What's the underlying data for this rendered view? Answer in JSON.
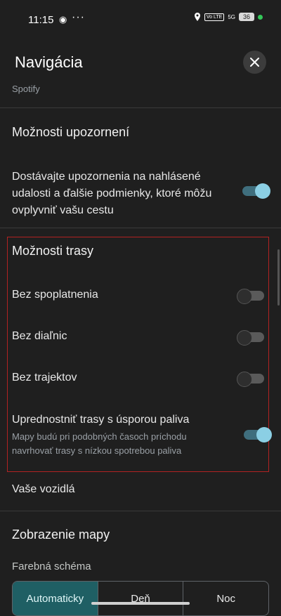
{
  "status": {
    "time": "11:15",
    "battery": "36",
    "net": "5G",
    "volte": "Vo LTE"
  },
  "header": {
    "title": "Navigácia"
  },
  "spotify_label": "Spotify",
  "notifications": {
    "title": "Možnosti upozornení",
    "description": "Dostávajte upozornenia na nahlásené udalosti a ďalšie podmienky, ktoré môžu ovplyvniť vašu cestu",
    "enabled": true
  },
  "route_options": {
    "title": "Možnosti trasy",
    "items": [
      {
        "label": "Bez spoplatnenia",
        "enabled": false
      },
      {
        "label": "Bez diaľnic",
        "enabled": false
      },
      {
        "label": "Bez trajektov",
        "enabled": false
      },
      {
        "label": "Uprednostniť trasy s úsporou paliva",
        "sub": "Mapy budú pri podobných časoch príchodu navrhovať trasy s nízkou spotrebou paliva",
        "enabled": true
      }
    ]
  },
  "vehicles_label": "Vaše vozidlá",
  "map_display": {
    "title": "Zobrazenie mapy",
    "color_scheme_label": "Farebná schéma",
    "options": [
      "Automaticky",
      "Deň",
      "Noc"
    ],
    "selected": "Automaticky"
  },
  "colors": {
    "accent": "#8bcfe4",
    "highlight_border": "#b22222",
    "selected_segment": "#1f5f64"
  }
}
